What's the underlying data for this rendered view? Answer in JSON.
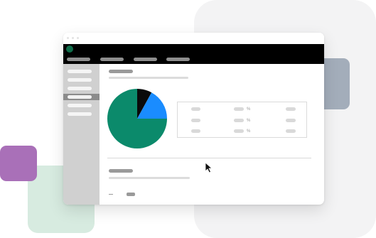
{
  "colors": {
    "pie_green": "#0b8a6b",
    "pie_blue": "#1a8cff",
    "pie_black": "#0a0a0a",
    "app_bar": "#000000",
    "purple_accent": "#a970b8",
    "slate_accent": "#a3adba",
    "mint_accent": "#d7ebe0"
  },
  "icons": {
    "app_logo": "app-logo-icon",
    "cursor": "mouse-pointer-icon"
  },
  "chart_data": {
    "type": "pie",
    "slices": [
      {
        "value": 0.08,
        "color": "#0a0a0a"
      },
      {
        "value": 0.17,
        "color": "#1a8cff"
      },
      {
        "value": 0.75,
        "color": "#0b8a6b"
      }
    ]
  },
  "table": {
    "rows": [
      {
        "symbol": "%"
      },
      {
        "symbol": "%"
      },
      {
        "symbol": "%"
      }
    ]
  },
  "bottom": {
    "dash": "–"
  }
}
